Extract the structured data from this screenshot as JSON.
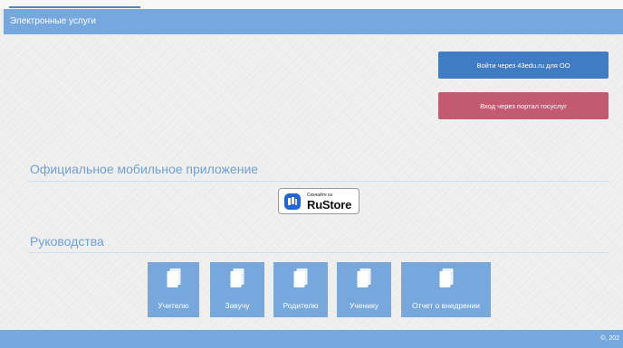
{
  "header": {
    "title": "Электронные услуги"
  },
  "auth": {
    "edu_login": "Войти через 43edu.ru для ОО",
    "gosuslugi_login": "Вход через портал госуслуг"
  },
  "mobile": {
    "title": "Официальное мобильное приложение",
    "store_small": "Скачайте из",
    "store_name": "RuStore"
  },
  "guides": {
    "title": "Руководства",
    "items": [
      {
        "label": "Учителю"
      },
      {
        "label": "Завучу"
      },
      {
        "label": "Родителю"
      },
      {
        "label": "Ученику"
      },
      {
        "label": "Отчет о внедрении"
      }
    ]
  },
  "footer": {
    "text": "©, 202"
  },
  "colors": {
    "header": "#76a8de",
    "edu_button": "#3f7cc3",
    "gos_button": "#c35a70"
  }
}
